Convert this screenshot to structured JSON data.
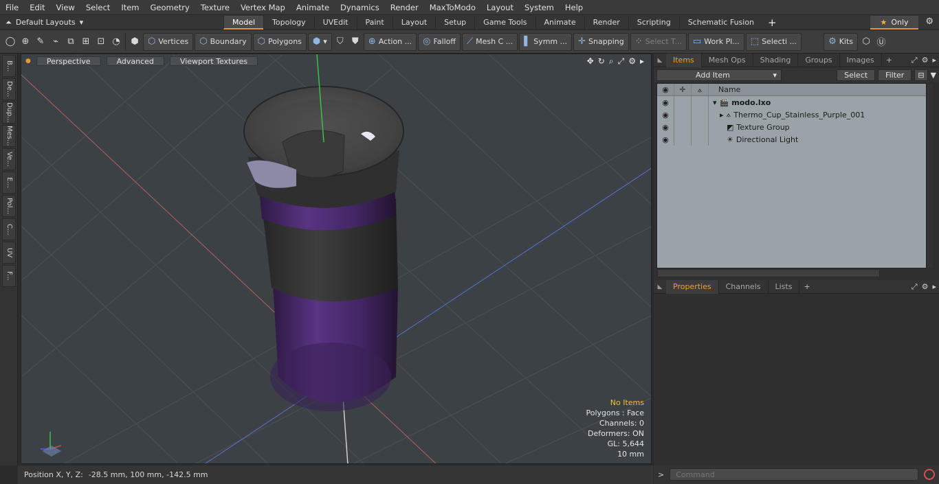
{
  "menu": [
    "File",
    "Edit",
    "View",
    "Select",
    "Item",
    "Geometry",
    "Texture",
    "Vertex Map",
    "Animate",
    "Dynamics",
    "Render",
    "MaxToModo",
    "Layout",
    "System",
    "Help"
  ],
  "layouts": {
    "label": "Default Layouts"
  },
  "tabs": [
    "Model",
    "Topology",
    "UVEdit",
    "Paint",
    "Layout",
    "Setup",
    "Game Tools",
    "Animate",
    "Render",
    "Scripting",
    "Schematic Fusion"
  ],
  "only_label": "Only",
  "toolbar": {
    "vertices": "Vertices",
    "boundary": "Boundary",
    "polygons": "Polygons",
    "action": "Action ...",
    "falloff": "Falloff",
    "mesh": "Mesh C ...",
    "symm": "Symm ...",
    "snapping": "Snapping",
    "select_t": "Select T...",
    "work_pl": "Work Pl...",
    "selecti": "Selecti ...",
    "kits": "Kits"
  },
  "left_tabs": [
    "B...",
    "De...",
    "Dup...",
    "Mes...",
    "Ve...",
    "E...",
    "Pol...",
    "C...",
    "UV",
    "F..."
  ],
  "viewport": {
    "perspective": "Perspective",
    "advanced": "Advanced",
    "textures": "Viewport Textures",
    "hud": {
      "no_items": "No Items",
      "polygons": "Polygons : Face",
      "channels": "Channels: 0",
      "deformers": "Deformers: ON",
      "gl": "GL: 5,644",
      "unit": "10 mm"
    }
  },
  "status": {
    "label": "Position X, Y, Z:",
    "value": "-28.5 mm, 100 mm, -142.5 mm"
  },
  "items_panel": {
    "tabs": [
      "Items",
      "Mesh Ops",
      "Shading",
      "Groups",
      "Images"
    ],
    "add_item": "Add Item",
    "select": "Select",
    "filter": "Filter",
    "name_header": "Name",
    "rows": [
      {
        "label": "modo.lxo"
      },
      {
        "label": "Thermo_Cup_Stainless_Purple_001"
      },
      {
        "label": "Texture Group"
      },
      {
        "label": "Directional Light"
      }
    ]
  },
  "properties_panel": {
    "tabs": [
      "Properties",
      "Channels",
      "Lists"
    ]
  },
  "command": {
    "placeholder": "Command"
  },
  "colors": {
    "accent": "#e89a2c",
    "viewport_bg": "#3b4145",
    "cup_purple": "#4b2a6b",
    "cup_dark": "#333333"
  }
}
